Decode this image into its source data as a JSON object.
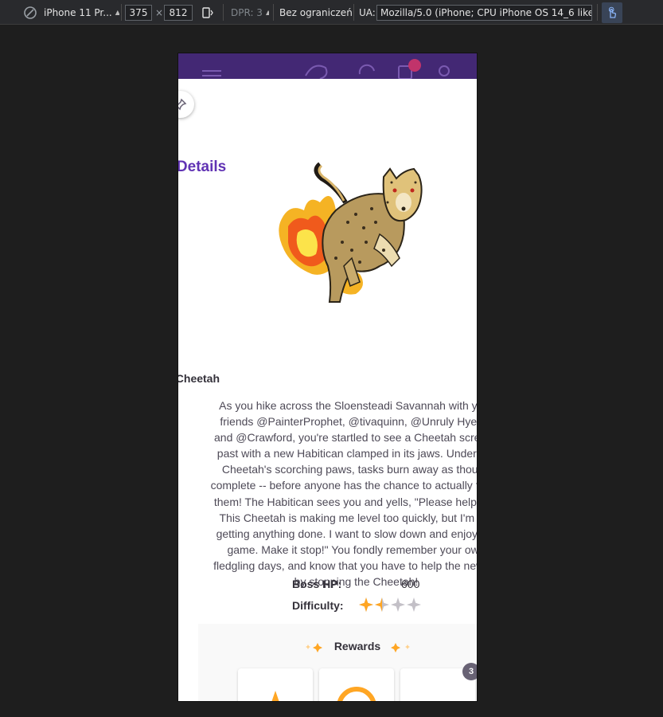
{
  "devtools": {
    "device_name": "iPhone 11 Pr...",
    "width": "375",
    "times": "×",
    "height": "812",
    "dpr": "DPR: 3",
    "throttle": "Bez ograniczeń",
    "ua_label": "UA:",
    "ua_value": "Mozilla/5.0 (iPhone; CPU iPhone OS 14_6 like Mac"
  },
  "quest": {
    "heading": "Quest Details",
    "name": "Such a Cheetah",
    "description": "As you hike across the Sloensteadi Savannah with your friends @PainterProphet, @tivaquinn, @Unruly Hyena, and @Crawford, you're startled to see a Cheetah screech past with a new Habitican clamped in its jaws. Under the Cheetah's scorching paws, tasks burn away as though complete -- before anyone has the chance to actually finish them! The Habitican sees you and yells, \"Please help me! This Cheetah is making me level too quickly, but I'm not getting anything done. I want to slow down and enjoy the game. Make it stop!\" You fondly remember your own fledgling days, and know that you have to help the newbie by stopping the Cheetah!",
    "boss_hp_label": "Boss HP:",
    "boss_hp_value": "600",
    "difficulty_label": "Difficulty:",
    "difficulty_stars": 1.5,
    "difficulty_max": 4,
    "rewards_title": "Rewards",
    "rewards_badge": "3"
  },
  "colors": {
    "brand_purple": "#6133b4",
    "appbar": "#432874",
    "star_gold": "#ffa624",
    "star_gray": "#c3c0c7"
  }
}
